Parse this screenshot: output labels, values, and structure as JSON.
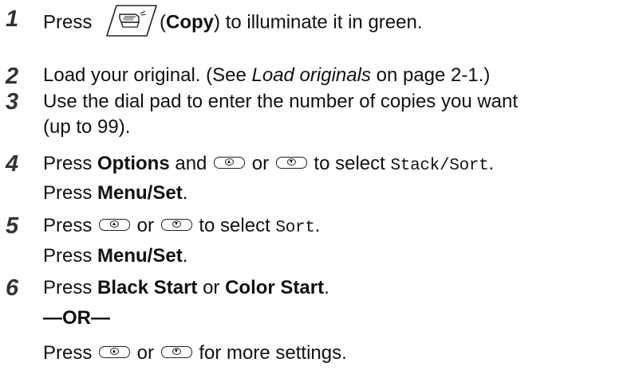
{
  "steps": [
    {
      "num": "1",
      "pre": "Press",
      "bold": "Copy",
      "post": ") to illuminate it in green.",
      "open_paren": "("
    },
    {
      "num": "2",
      "pre": "Load your original. (See ",
      "italic": "Load originals",
      "post": " on page 2-1.)"
    },
    {
      "num": "3",
      "line1": "Use the dial pad to enter the number of copies you want",
      "line2": "(up to 99)."
    },
    {
      "num": "4",
      "pre": "Press ",
      "bold": "Options",
      "mid": " and ",
      "or": " or ",
      "post": " to select ",
      "mono": "Stack/Sort",
      "end": ".",
      "line2_pre": "Press ",
      "line2_bold": "Menu/Set",
      "line2_end": "."
    },
    {
      "num": "5",
      "pre": "Press ",
      "or": " or ",
      "post": " to select ",
      "mono": "Sort",
      "end": ".",
      "line2_pre": "Press ",
      "line2_bold": "Menu/Set",
      "line2_end": "."
    },
    {
      "num": "6",
      "pre": "Press ",
      "bold1": "Black Start",
      "or_text": " or ",
      "bold2": "Color Start",
      "end": ".",
      "or_line": "—OR—",
      "line3_pre": "Press ",
      "or": " or ",
      "line3_post": " for more settings."
    }
  ],
  "icons": {
    "copy_key": "copy-key-icon",
    "up_key": "up-arrow-key-icon",
    "down_key": "down-arrow-key-icon"
  }
}
